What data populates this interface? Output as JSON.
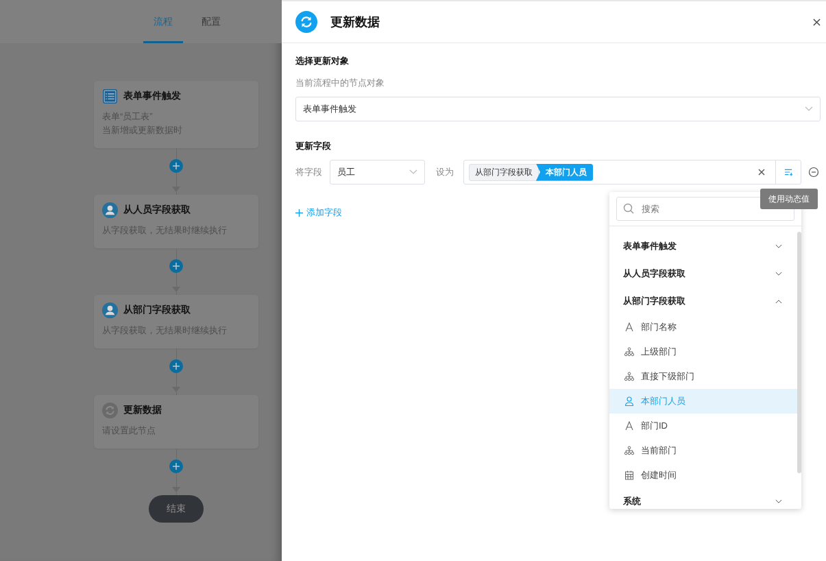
{
  "tabs": [
    {
      "label": "流程",
      "selected": true
    },
    {
      "label": "配置",
      "selected": false
    }
  ],
  "flow": {
    "nodes": [
      {
        "kind": "form",
        "title": "表单事件触发",
        "lines": [
          "表单“员工表”",
          "当新增或更新数据时"
        ]
      },
      {
        "kind": "person",
        "title": "从人员字段获取",
        "lines": [
          "从字段获取，无结果时继续执行"
        ]
      },
      {
        "kind": "person",
        "title": "从部门字段获取",
        "lines": [
          "从字段获取，无结果时继续执行"
        ]
      },
      {
        "kind": "update",
        "title": "更新数据",
        "lines": [
          "请设置此节点"
        ]
      }
    ],
    "end": "结束"
  },
  "panel": {
    "title": "更新数据",
    "target": {
      "heading": "选择更新对象",
      "hint": "当前流程中的节点对象",
      "value": "表单事件触发"
    },
    "fields": {
      "heading": "更新字段",
      "field_label": "将字段",
      "field_value": "员工",
      "set_label": "设为",
      "tags": [
        {
          "label": "从部门字段获取",
          "selected": false
        },
        {
          "label": "本部门人员",
          "selected": true
        }
      ]
    },
    "add_label": "添加字段"
  },
  "tooltip": "使用动态值",
  "dropdown": {
    "placeholder": "搜索",
    "groups": [
      {
        "label": "表单事件触发",
        "expanded": false
      },
      {
        "label": "从人员字段获取",
        "expanded": false
      },
      {
        "label": "从部门字段获取",
        "expanded": true,
        "children": [
          {
            "kind": "text",
            "label": "部门名称",
            "selected": false
          },
          {
            "kind": "org",
            "label": "上级部门",
            "selected": false
          },
          {
            "kind": "org",
            "label": "直接下级部门",
            "selected": false
          },
          {
            "kind": "person",
            "label": "本部门人员",
            "selected": true
          },
          {
            "kind": "text",
            "label": "部门ID",
            "selected": false
          },
          {
            "kind": "org",
            "label": "当前部门",
            "selected": false
          },
          {
            "kind": "date",
            "label": "创建时间",
            "selected": false
          }
        ]
      },
      {
        "label": "系统",
        "expanded": false
      }
    ]
  }
}
